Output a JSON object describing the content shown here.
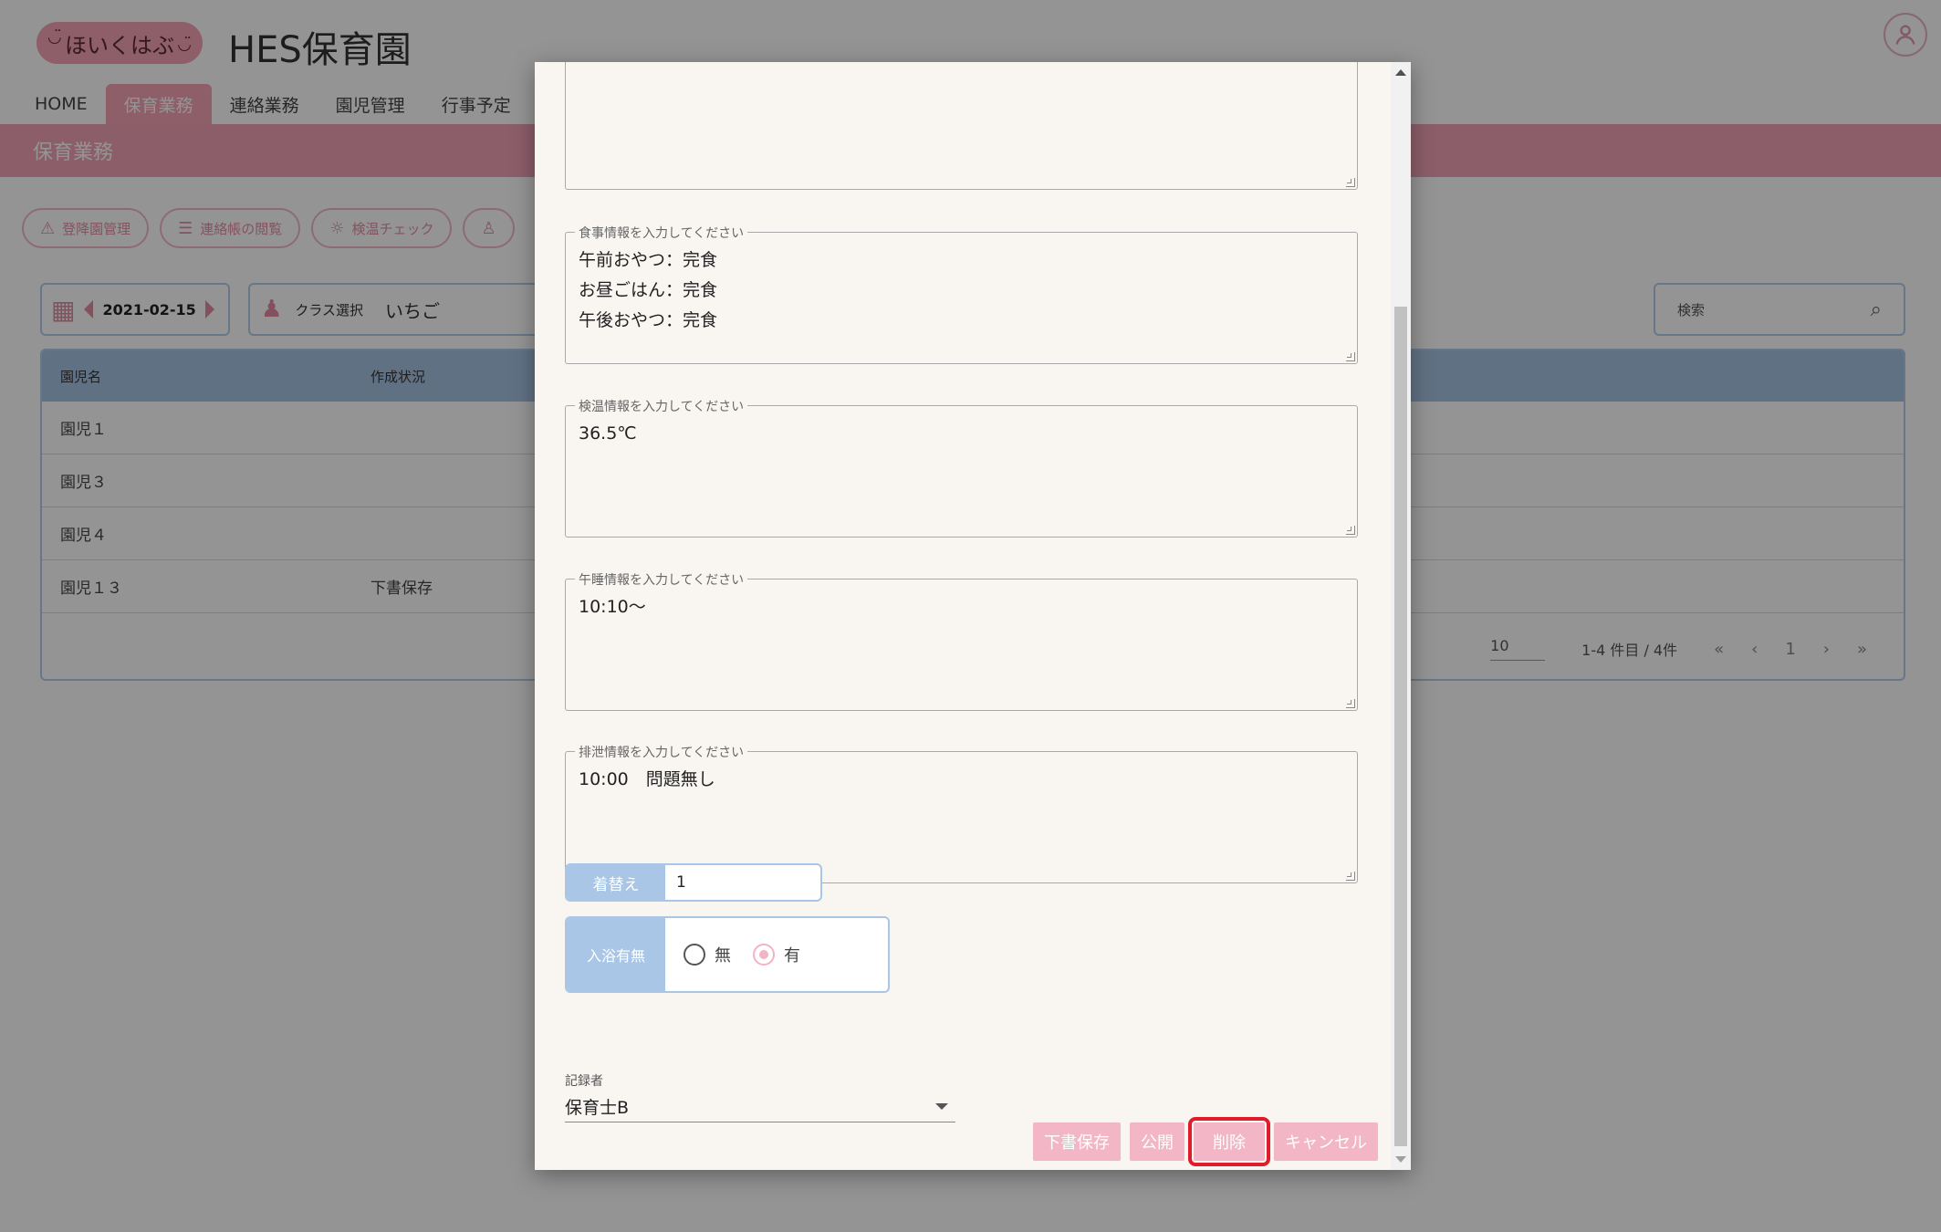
{
  "app": {
    "logo_text": "ほいくはぶ",
    "title": "HES保育園"
  },
  "nav": {
    "tabs": [
      "HOME",
      "保育業務",
      "連絡業務",
      "園児管理",
      "行事予定"
    ]
  },
  "section_title": "保育業務",
  "actions": [
    "登降園管理",
    "連絡帳の閲覧",
    "検温チェック"
  ],
  "toolbar": {
    "date": "2021-02-15",
    "class_label": "クラス選択",
    "class_value": "いちご",
    "search_label": "検索"
  },
  "table": {
    "headers": [
      "園児名",
      "作成状況"
    ],
    "rows": [
      [
        "園児１",
        ""
      ],
      [
        "園児３",
        ""
      ],
      [
        "園児４",
        ""
      ],
      [
        "園児１３",
        "下書保存"
      ]
    ],
    "rows_per_page": "10",
    "range_text": "1-4 件目 / 4件",
    "page": "1"
  },
  "modal": {
    "meal": {
      "legend": "食事情報を入力してください",
      "value": "午前おやつ：完食\nお昼ごはん：完食\n午後おやつ：完食"
    },
    "temp": {
      "legend": "検温情報を入力してください",
      "value": "36.5℃"
    },
    "nap": {
      "legend": "午睡情報を入力してください",
      "value": "10:10～"
    },
    "excretion": {
      "legend": "排泄情報を入力してください",
      "value": "10:00　問題無し"
    },
    "change": {
      "label": "着替え",
      "value": "1"
    },
    "bath": {
      "label": "入浴有無",
      "option_no": "無",
      "option_yes": "有",
      "selected": "有"
    },
    "recorder": {
      "label": "記録者",
      "value": "保育士B"
    },
    "buttons": {
      "draft": "下書保存",
      "publish": "公開",
      "delete": "削除",
      "cancel": "キャンセル"
    }
  },
  "colors": {
    "pink_accent": "#f2a3b7",
    "blue_accent": "#a9c6e6",
    "highlight_red": "#e01b2c"
  }
}
